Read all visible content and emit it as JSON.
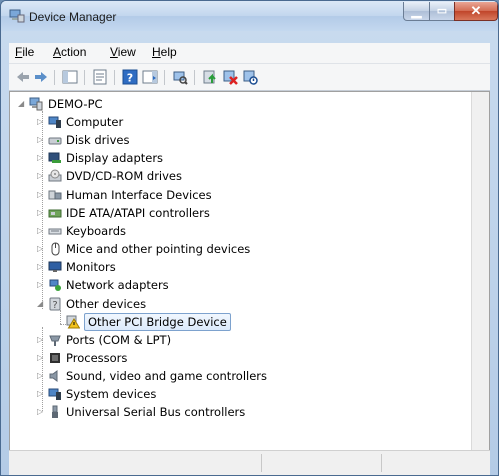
{
  "window": {
    "title": "Device Manager"
  },
  "menu": [
    "File",
    "Action",
    "View",
    "Help"
  ],
  "menu_underline": [
    "F",
    "A",
    "V",
    "H"
  ],
  "toolbar_icons": [
    "back-arrow-icon",
    "forward-arrow-icon",
    "show-hide-console-tree-icon",
    "properties-icon",
    "help-icon",
    "action-pane-icon",
    "scan-hardware-icon",
    "update-driver-icon",
    "uninstall-icon",
    "disable-device-icon"
  ],
  "tree": {
    "root": "DEMO-PC",
    "items": [
      {
        "label": "Computer",
        "icon": "computer-icon"
      },
      {
        "label": "Disk drives",
        "icon": "disk-drive-icon"
      },
      {
        "label": "Display adapters",
        "icon": "display-adapter-icon"
      },
      {
        "label": "DVD/CD-ROM drives",
        "icon": "dvd-drive-icon"
      },
      {
        "label": "Human Interface Devices",
        "icon": "hid-icon"
      },
      {
        "label": "IDE ATA/ATAPI controllers",
        "icon": "ide-controller-icon"
      },
      {
        "label": "Keyboards",
        "icon": "keyboard-icon"
      },
      {
        "label": "Mice and other pointing devices",
        "icon": "mouse-icon"
      },
      {
        "label": "Monitors",
        "icon": "monitor-icon"
      },
      {
        "label": "Network adapters",
        "icon": "network-adapter-icon"
      },
      {
        "label": "Other devices",
        "icon": "other-devices-icon"
      },
      {
        "label": "Other PCI Bridge Device",
        "icon": "warning-device-icon"
      },
      {
        "label": "Ports (COM & LPT)",
        "icon": "port-icon"
      },
      {
        "label": "Processors",
        "icon": "processor-icon"
      },
      {
        "label": "Sound, video and game controllers",
        "icon": "sound-icon"
      },
      {
        "label": "System devices",
        "icon": "system-device-icon"
      },
      {
        "label": "Universal Serial Bus controllers",
        "icon": "usb-icon"
      }
    ]
  },
  "colors": {
    "selection": "#dceafb",
    "warning": "#f2c21b"
  }
}
